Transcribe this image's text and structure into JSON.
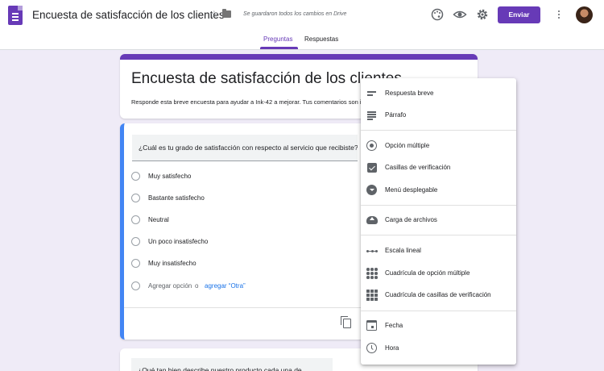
{
  "header": {
    "doc_title": "Encuesta de satisfacción de los clientes",
    "saved_status": "Se guardaron todos los cambios en Drive",
    "icons": [
      "palette-icon",
      "eye-icon",
      "gear-icon"
    ],
    "send_label": "Enviar"
  },
  "tabs": [
    {
      "label": "Preguntas",
      "active": true
    },
    {
      "label": "Respuestas",
      "active": false
    }
  ],
  "colors": {
    "accent": "#673ab7",
    "focus": "#4285f4",
    "link": "#1a73e8",
    "background": "#efebf7"
  },
  "form": {
    "title": "Encuesta de satisfacción de los clientes",
    "description": "Responde esta breve encuesta para ayudar a Ink-42 a mejorar. Tus comentarios son importantes."
  },
  "question1": {
    "text": "¿Cuál es tu grado de satisfacción con respecto al servicio que recibiste?",
    "options": [
      "Muy satisfecho",
      "Bastante satisfecho",
      "Neutral",
      "Un poco insatisfecho",
      "Muy insatisfecho"
    ],
    "add_option": "Agregar opción",
    "or_text": "o",
    "add_other": "agregar “Otra”"
  },
  "question2": {
    "text": "¿Qué tan bien describe nuestro producto cada una de"
  },
  "type_menu": {
    "groups": [
      [
        {
          "label": "Respuesta breve",
          "icon": "short-answer-icon"
        },
        {
          "label": "Párrafo",
          "icon": "paragraph-icon"
        }
      ],
      [
        {
          "label": "Opción múltiple",
          "icon": "radio-icon"
        },
        {
          "label": "Casillas de verificación",
          "icon": "checkbox-icon"
        },
        {
          "label": "Menú desplegable",
          "icon": "dropdown-icon"
        }
      ],
      [
        {
          "label": "Carga de archivos",
          "icon": "cloud-upload-icon"
        }
      ],
      [
        {
          "label": "Escala lineal",
          "icon": "linear-scale-icon"
        },
        {
          "label": "Cuadrícula de opción múltiple",
          "icon": "grid-dots-icon"
        },
        {
          "label": "Cuadrícula de casillas de verificación",
          "icon": "grid-squares-icon"
        }
      ],
      [
        {
          "label": "Fecha",
          "icon": "calendar-icon"
        },
        {
          "label": "Hora",
          "icon": "clock-icon"
        }
      ]
    ]
  }
}
